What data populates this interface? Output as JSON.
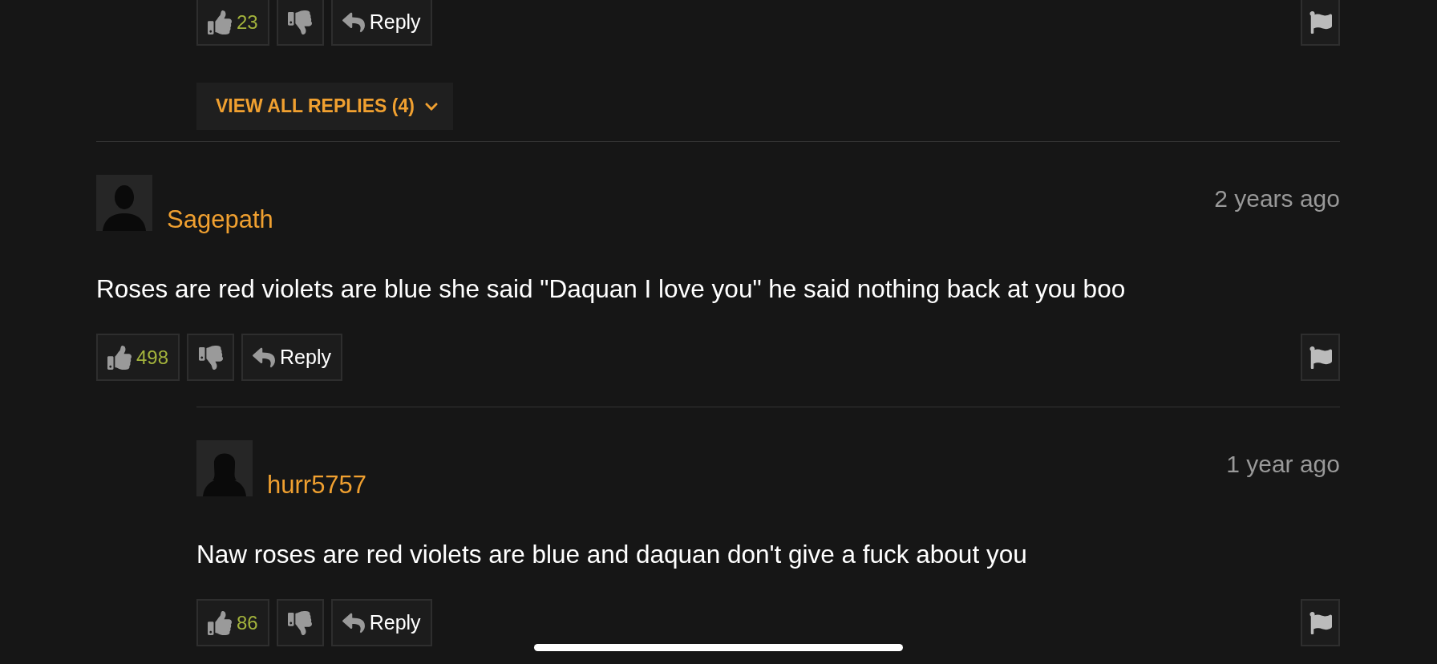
{
  "top_actions": {
    "likes": "23",
    "reply_label": "Reply"
  },
  "view_all_replies": {
    "label": "VIEW ALL REPLIES (4)"
  },
  "comments": [
    {
      "kind": "male",
      "username": "Sagepath",
      "time": "2 years ago",
      "text": "Roses are red violets are blue she said \"Daquan I love you\" he said nothing back at you boo",
      "likes": "498",
      "reply_label": "Reply",
      "replies": [
        {
          "kind": "female",
          "username": "hurr5757",
          "time": "1 year ago",
          "text": "Naw roses are red violets are blue and daquan don't give a fuck about you",
          "likes": "86",
          "reply_label": "Reply"
        }
      ]
    }
  ]
}
